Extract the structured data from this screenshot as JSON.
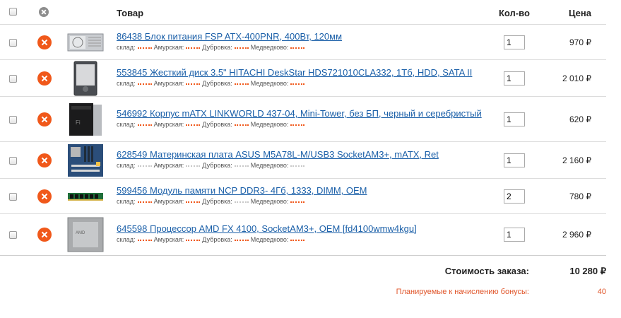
{
  "header": {
    "product": "Товар",
    "qty": "Кол-во",
    "price": "Цена"
  },
  "stock_labels": {
    "warehouse": "склад:",
    "amurskaya": "Амурская:",
    "dubrovka": "Дубровка:",
    "medvedkovo": "Медведково:"
  },
  "items": [
    {
      "title": "86438 Блок питания FSP ATX-400PNR, 400Вт, 120мм",
      "qty": "1",
      "price": "970 ₽",
      "image": "power-supply",
      "stock": [
        "orange",
        "orange",
        "orange",
        "orange"
      ]
    },
    {
      "title": "553845 Жесткий диск 3.5\" HITACHI DeskStar HDS721010CLA332, 1Тб, HDD, SATA II",
      "qty": "1",
      "price": "2 010 ₽",
      "image": "hard-drive",
      "stock": [
        "orange",
        "orange",
        "orange",
        "orange"
      ]
    },
    {
      "title": "546992 Корпус mATX LINKWORLD 437-04, Mini-Tower, без БП, черный и серебристый",
      "qty": "1",
      "price": "620 ₽",
      "image": "pc-case",
      "stock": [
        "orange",
        "orange",
        "orange",
        "orange"
      ]
    },
    {
      "title": "628549 Материнская плата ASUS M5A78L-M/USB3 SocketAM3+, mATX, Ret",
      "qty": "1",
      "price": "2 160 ₽",
      "image": "motherboard",
      "stock": [
        "grey",
        "grey",
        "grey",
        "grey"
      ]
    },
    {
      "title": "599456 Модуль памяти NCP DDR3- 4Гб, 1333, DIMM, OEM",
      "qty": "2",
      "price": "780 ₽",
      "image": "memory-module",
      "stock": [
        "orange",
        "orange",
        "grey",
        "orange"
      ]
    },
    {
      "title": "645598 Процессор AMD FX 4100, SocketAM3+, OEM [fd4100wmw4kgu]",
      "qty": "1",
      "price": "2 960 ₽",
      "image": "cpu",
      "stock": [
        "orange",
        "orange",
        "orange",
        "orange"
      ]
    }
  ],
  "summary": {
    "total_label": "Стоимость заказа:",
    "total_value": "10 280 ₽",
    "bonus_label": "Планируемые к начислению бонусы:",
    "bonus_value": "40"
  },
  "colors": {
    "accent": "#f0581a",
    "link": "#1a5fa8",
    "bonus": "#e0552a"
  }
}
